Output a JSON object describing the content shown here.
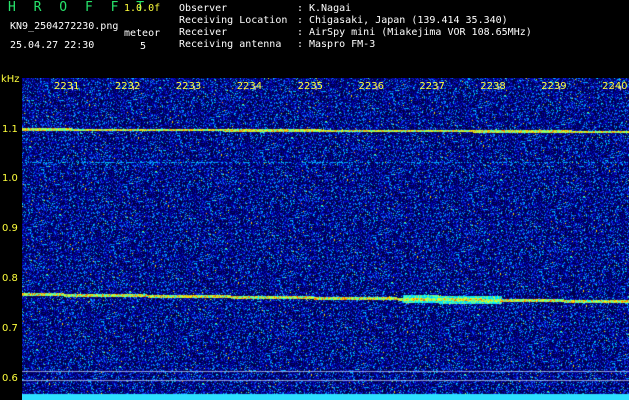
{
  "app": {
    "title": "H R O F F T",
    "version": "1.0.0f",
    "filename": "KN9_2504272230.png",
    "datetime": "25.04.27 22:30",
    "meteor_label": "meteor",
    "meteor_count": "5"
  },
  "meta": [
    {
      "key": "Observer",
      "value": "K.Nagai"
    },
    {
      "key": "Receiving Location",
      "value": "Chigasaki, Japan (139.414 35.340)"
    },
    {
      "key": "Receiver",
      "value": "AirSpy mini (Miakejima VOR 108.65MHz)"
    },
    {
      "key": "Receiving antenna",
      "value": "Maspro FM-3"
    }
  ],
  "axis": {
    "freq_unit": "kHz",
    "freq_labels": [
      "1.1",
      "1.0",
      "0.9",
      "0.8",
      "0.7",
      "0.6"
    ],
    "time_labels": [
      "2231",
      "2232",
      "2233",
      "2234",
      "2235",
      "2236",
      "2237",
      "2238",
      "2239",
      "2240"
    ]
  },
  "colors": {
    "background": "#000000",
    "noise_blue": "#1a3cff",
    "header_green": "#27e36b",
    "label_yellow": "#ffff3c"
  }
}
